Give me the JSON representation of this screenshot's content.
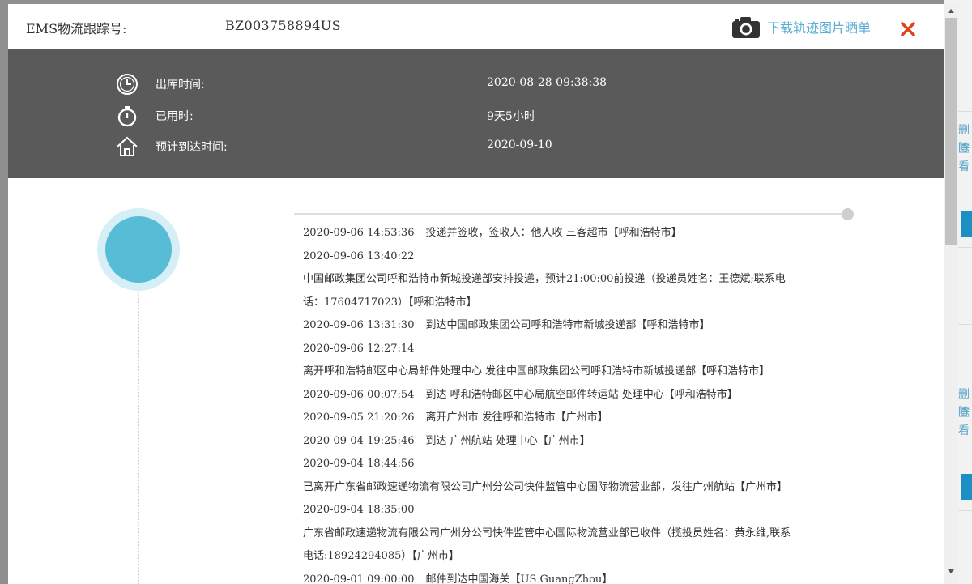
{
  "header": {
    "label": "EMS物流跟踪号:",
    "tracking_number": "BZ003758894US",
    "download_link": "下载轨迹图片晒单",
    "camera_icon": "camera-icon",
    "close_icon": "close-icon"
  },
  "info": {
    "rows": [
      {
        "icon": "clock-icon",
        "label": "出库时间:",
        "value": "2020-08-28 09:38:38"
      },
      {
        "icon": "stopwatch-icon",
        "label": "已用时:",
        "value": "9天5小时"
      },
      {
        "icon": "home-icon",
        "label": "预计到达时间:",
        "value": "2020-09-10"
      }
    ]
  },
  "events": [
    {
      "time": "2020-09-06 14:53:36",
      "text": "投递并签收，签收人：他人收 三客超市【呼和浩特市】"
    },
    {
      "time": "2020-09-06 13:40:22",
      "text": ""
    },
    {
      "time": "",
      "text": "中国邮政集团公司呼和浩特市新城投递部安排投递，预计21:00:00前投递（投递员姓名：王德斌;联系电"
    },
    {
      "time": "",
      "text": "话：17604717023）【呼和浩特市】"
    },
    {
      "time": "2020-09-06 13:31:30",
      "text": "到达中国邮政集团公司呼和浩特市新城投递部【呼和浩特市】"
    },
    {
      "time": "2020-09-06 12:27:14",
      "text": ""
    },
    {
      "time": "",
      "text": "离开呼和浩特邮区中心局邮件处理中心 发往中国邮政集团公司呼和浩特市新城投递部【呼和浩特市】"
    },
    {
      "time": "2020-09-06 00:07:54",
      "text": "到达 呼和浩特邮区中心局航空邮件转运站 处理中心【呼和浩特市】"
    },
    {
      "time": "2020-09-05 21:20:26",
      "text": "离开广州市 发往呼和浩特市【广州市】"
    },
    {
      "time": "2020-09-04 19:25:46",
      "text": "到达 广州航站 处理中心【广州市】"
    },
    {
      "time": "2020-09-04 18:44:56",
      "text": ""
    },
    {
      "time": "",
      "text": "已离开广东省邮政速递物流有限公司广州分公司快件监管中心国际物流营业部，发往广州航站【广州市】"
    },
    {
      "time": "2020-09-04 18:35:00",
      "text": ""
    },
    {
      "time": "",
      "text": "广东省邮政速递物流有限公司广州分公司快件监管中心国际物流营业部已收件（揽投员姓名：黄永维,联系"
    },
    {
      "time": "",
      "text": "电话:18924294085）【广州市】"
    },
    {
      "time": "2020-09-01 09:00:00",
      "text": "邮件到达中国海关【US GuangZhou】"
    }
  ],
  "background": {
    "fragments": [
      "删除",
      "查看",
      "删除",
      "查看"
    ]
  },
  "colors": {
    "accent": "#5aaed0",
    "info_bg": "#5a5a5a",
    "circle": "#57bdd6",
    "close": "#e0421b"
  }
}
